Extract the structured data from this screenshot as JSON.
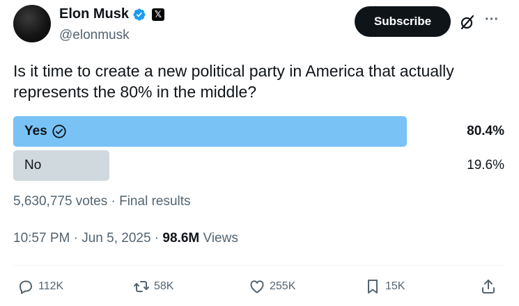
{
  "author": {
    "display_name": "Elon Musk",
    "handle": "@elonmusk",
    "affiliate_badge": "𝕏"
  },
  "header": {
    "subscribe_label": "Subscribe",
    "more_label": "···"
  },
  "tweet": {
    "text": "Is it time to create a new political party in America that actually represents the 80% in the middle?"
  },
  "poll": {
    "options": [
      {
        "label": "Yes",
        "percent_text": "80.4%",
        "percent": 80.4,
        "selected": true,
        "fill_color": "#79c2f6"
      },
      {
        "label": "No",
        "percent_text": "19.6%",
        "percent": 19.6,
        "selected": false,
        "fill_color": "#cfd9de"
      }
    ],
    "meta": "5,630,775 votes · Final results"
  },
  "timestamp": {
    "time_date": "10:57 PM · Jun 5, 2025 · ",
    "views_count": "98.6M",
    "views_label": " Views"
  },
  "actions": {
    "replies": "112K",
    "reposts": "58K",
    "likes": "255K",
    "bookmarks": "15K"
  },
  "colors": {
    "accent": "#1d9bf0",
    "text_primary": "#0f1419",
    "text_secondary": "#536471"
  }
}
